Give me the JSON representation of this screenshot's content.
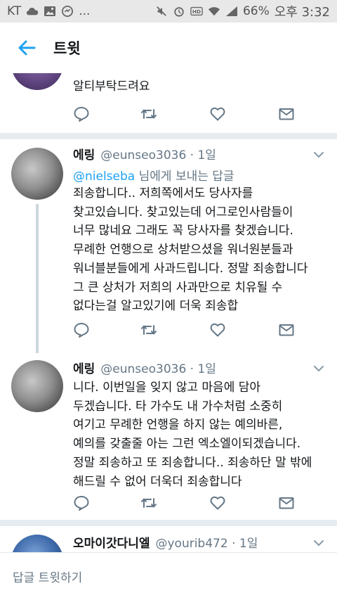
{
  "status_bar": {
    "carrier": "KT",
    "icons_left": [
      "cloud-icon",
      "image-icon",
      "messenger-icon"
    ],
    "more": "...",
    "icons_right": [
      "mute-icon",
      "alarm-icon",
      "hd-icon",
      "wifi-icon",
      "signal-icon"
    ],
    "battery": "66%",
    "time": "오후 3:32"
  },
  "app_bar": {
    "title": "트윗",
    "back_icon": "back-arrow-icon"
  },
  "tweets": [
    {
      "name": "",
      "handle": "",
      "body": "알티부탁드려요"
    },
    {
      "name": "에링",
      "handle": "@eunseo3036 · 1일",
      "reply_to": "@nielseba",
      "reply_suffix": " 님에게 보내는 답글",
      "body": "죄송합니다.. 저희쪽에서도 당사자를\n찾고있습니다. 찾고있는데 어그로인사람들이\n너무 많네요 그래도 꼭 당사자를 찾겠습니다.\n무례한 언행으로 상처받으셨을 워너원분들과\n워너블분들에게 사과드립니다. 정말 죄송합니다\n그 큰 상처가 저희의 사과만으로 치유될 수\n없다는걸 알고있기에 더욱 죄송합"
    },
    {
      "name": "에링",
      "handle": "@eunseo3036 · 1일",
      "body": "니다. 이번일을 잊지 않고 마음에 담아\n두겠습니다.  타 가수도 내 가수처럼 소중히\n여기고 무례한 언행을 하지 않는  예의바른,\n예의를 갖출줄 아는 그런 엑소엘이되겠습니다.\n정말 죄송하고 또 죄송합니다.. 죄송하단 말 밖에\n해드릴 수 없어 더욱더 죄송합니다"
    },
    {
      "name": "오마이갓다니엘",
      "handle": "@yourib472 · 1일"
    }
  ],
  "action_icons": [
    "reply-icon",
    "retweet-icon",
    "like-icon",
    "message-icon"
  ],
  "compose": {
    "placeholder": "답글 트윗하기"
  },
  "colors": {
    "accent": "#1da1f2",
    "secondary_text": "#657786",
    "divider": "#e6ecf0",
    "status_bar_bg": "#e8e8e8"
  }
}
